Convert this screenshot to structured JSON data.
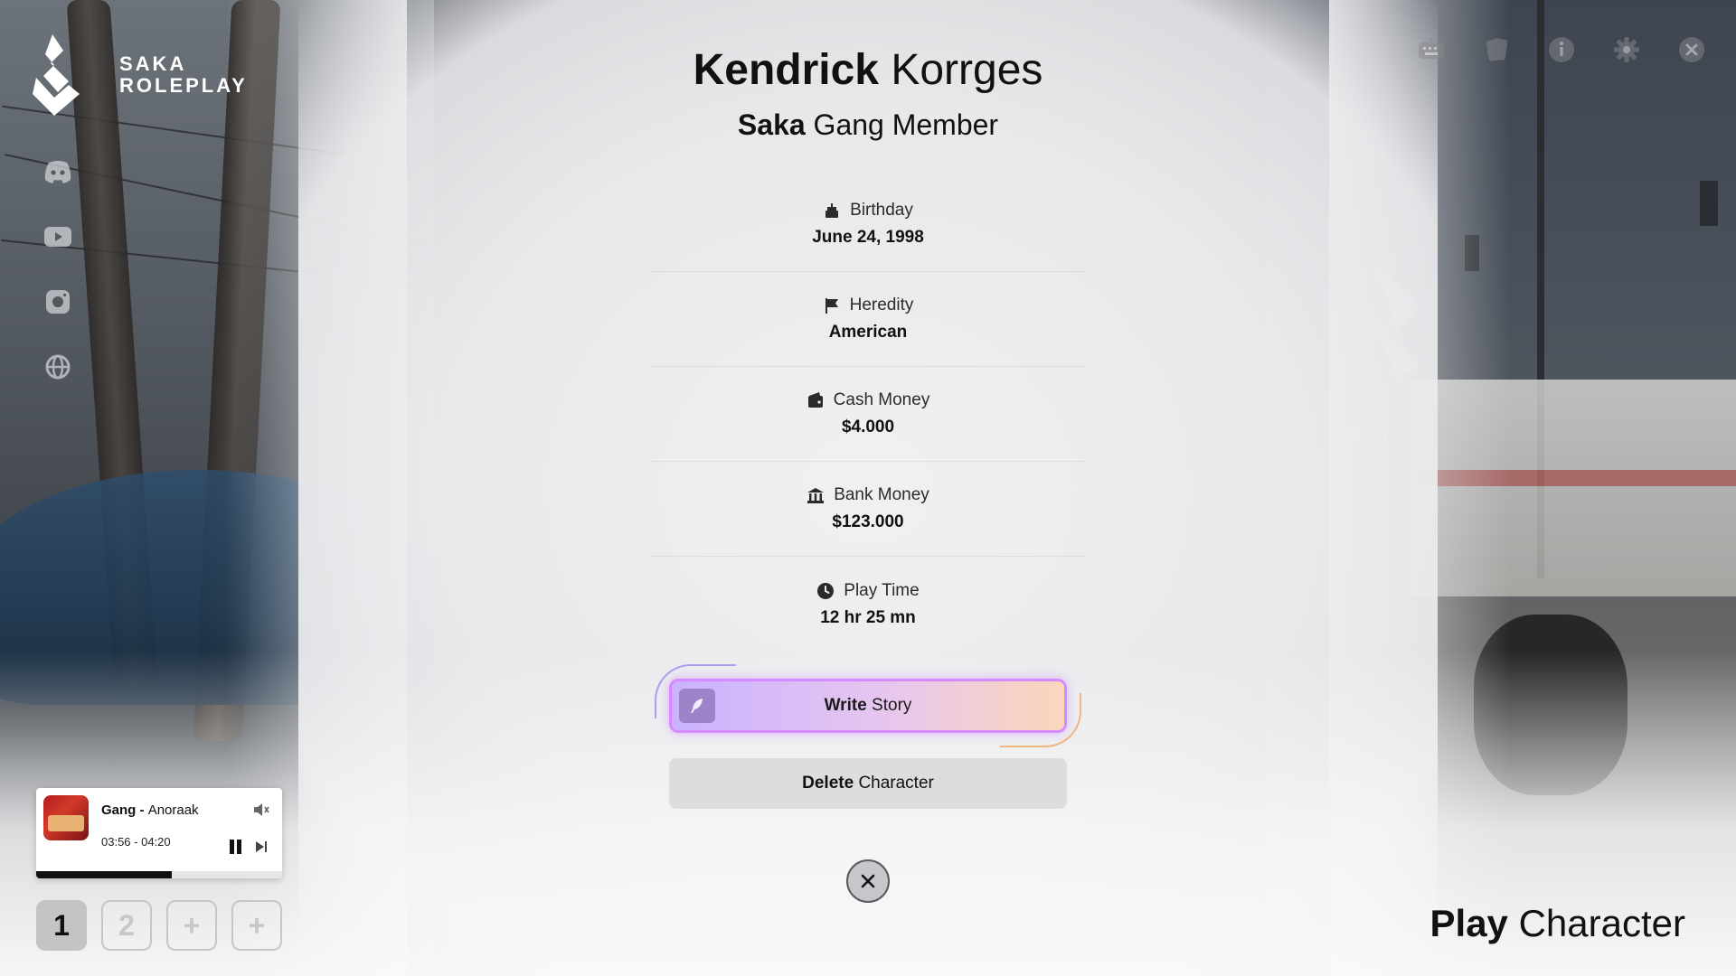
{
  "brand": {
    "line1": "SAKA",
    "line2": "ROLEPLAY"
  },
  "social": [
    "discord-icon",
    "youtube-icon",
    "instagram-icon",
    "globe-icon"
  ],
  "toolbar": [
    "keyboard-icon",
    "cards-icon",
    "info-icon",
    "gear-icon",
    "close-icon"
  ],
  "background": {
    "ghost_text": "mber"
  },
  "character": {
    "first_name": "Kendrick",
    "last_name": "Korrges",
    "org": "Saka",
    "role": "Gang Member",
    "stats": [
      {
        "icon": "cake-icon",
        "label": "Birthday",
        "value": "June 24, 1998"
      },
      {
        "icon": "flag-icon",
        "label": "Heredity",
        "value": "American"
      },
      {
        "icon": "wallet-icon",
        "label": "Cash Money",
        "value": "$4.000"
      },
      {
        "icon": "bank-icon",
        "label": "Bank Money",
        "value": "$123.000"
      },
      {
        "icon": "clock-icon",
        "label": "Play Time",
        "value": "12 hr 25 mn"
      }
    ]
  },
  "actions": {
    "write_bold": "Write",
    "write_rest": "Story",
    "delete_bold": "Delete",
    "delete_rest": "Character"
  },
  "player": {
    "artist": "Gang",
    "separator": " - ",
    "title": "Anoraak",
    "time": "03:56 - 04:20",
    "progress_fraction": 0.55
  },
  "slots": [
    "1",
    "2",
    "+",
    "+"
  ],
  "play": {
    "bold": "Play",
    "rest": "Character"
  },
  "colors": {
    "accent_purple": "#d58bff",
    "accent_orange": "#f1a867",
    "text": "#111111"
  }
}
